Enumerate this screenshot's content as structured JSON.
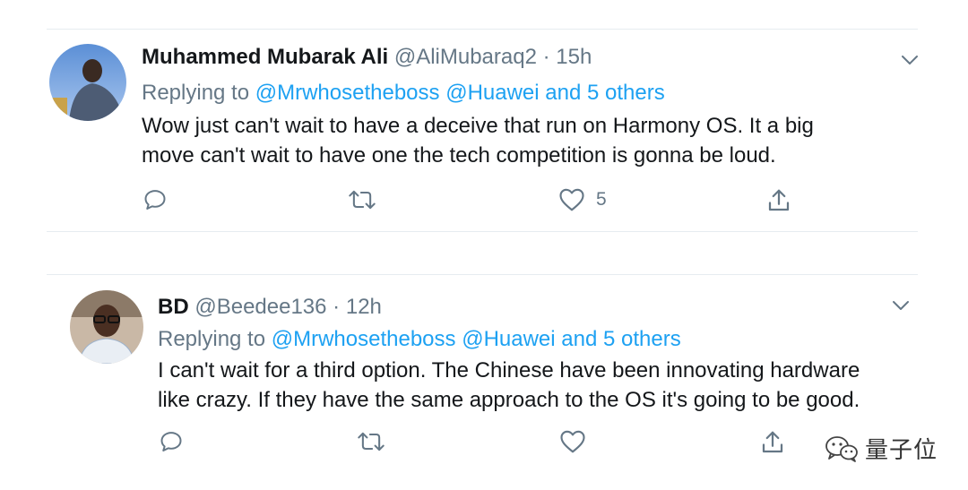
{
  "tweets": [
    {
      "name": "Muhammed Mubarak Ali",
      "handle": "@AliMubaraq2",
      "separator": "·",
      "time": "15h",
      "replying_prefix": "Replying to",
      "replying_users": "@Mrwhosetheboss @Huawei and 5 others",
      "text_line1": "Wow just can't wait to have a deceive that run on Harmony OS. It a big",
      "text_line2": "move can't wait to have one the tech competition is gonna be loud.",
      "reply_count": "",
      "retweet_count": "",
      "like_count": "5"
    },
    {
      "name": "BD",
      "handle": "@Beedee136",
      "separator": "·",
      "time": "12h",
      "replying_prefix": "Replying to",
      "replying_users": "@Mrwhosetheboss @Huawei and 5 others",
      "text_line1": "I can't wait for a third option. The Chinese have been innovating hardware",
      "text_line2": "like crazy. If they have the same approach to the OS it's going to be good.",
      "reply_count": "",
      "retweet_count": "",
      "like_count": ""
    }
  ],
  "icons": {
    "reply": "reply-icon",
    "retweet": "retweet-icon",
    "like": "heart-icon",
    "share": "share-icon",
    "caret": "chevron-down-icon"
  },
  "watermark": {
    "text": "量子位"
  },
  "colors": {
    "link": "#1da1f2",
    "muted": "#657786",
    "text": "#14171a",
    "divider": "#e6ecf0"
  }
}
